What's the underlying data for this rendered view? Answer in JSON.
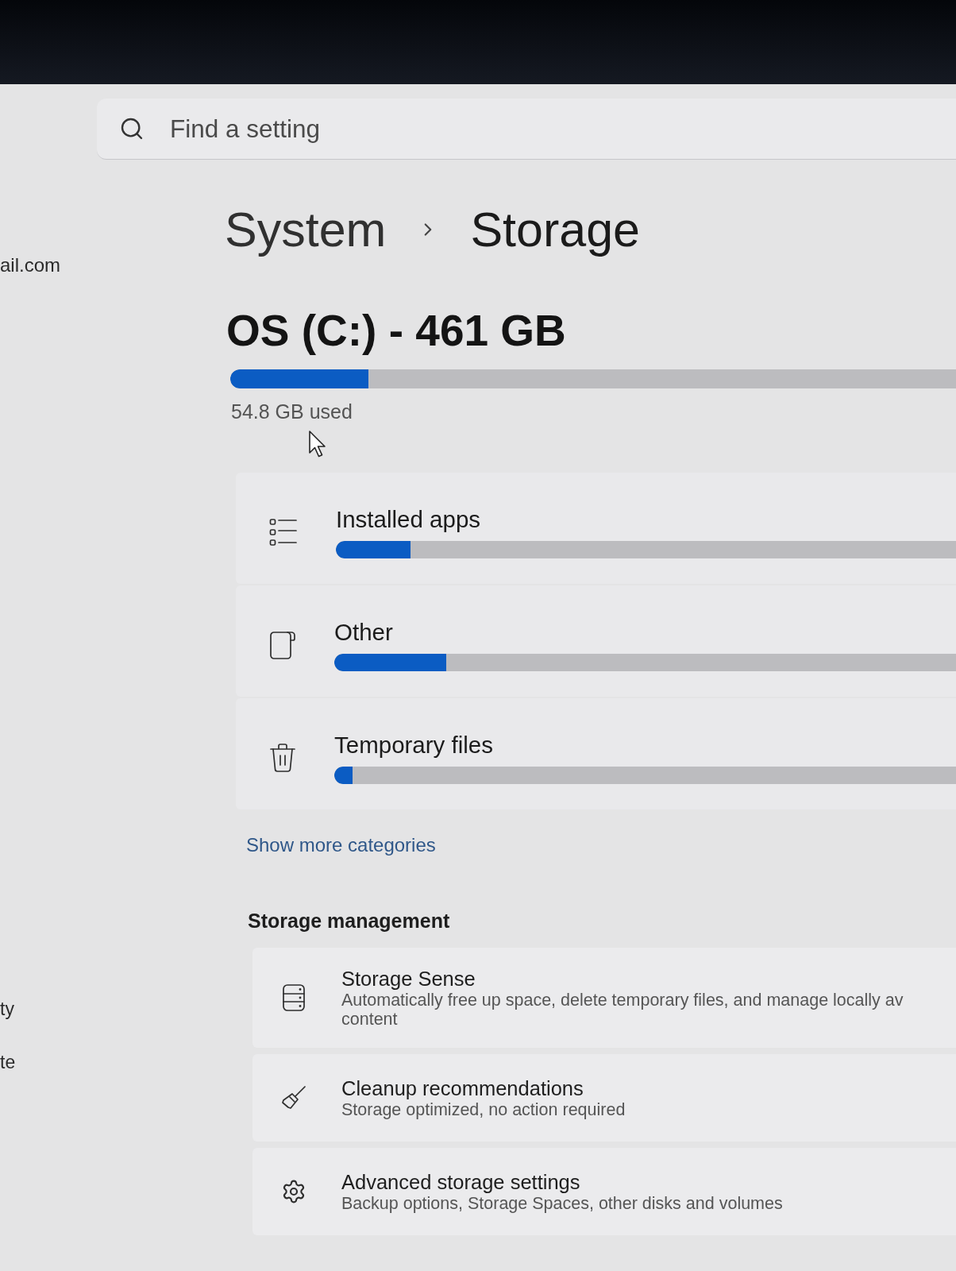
{
  "search": {
    "placeholder": "Find a setting"
  },
  "sidebar": {
    "account_email": "ail.com",
    "items": [
      {
        "label": "ty"
      },
      {
        "label": "te"
      }
    ]
  },
  "breadcrumb": [
    {
      "label": "System"
    },
    {
      "label": "Storage"
    }
  ],
  "drive": {
    "title": "OS (C:) - 461 GB",
    "level": 0.19,
    "used": "54.8 GB used"
  },
  "categories": [
    {
      "kind": "apps",
      "label": "Installed apps",
      "level": 0.12
    },
    {
      "kind": "other",
      "label": "Other",
      "level": 0.18
    },
    {
      "kind": "temp",
      "label": "Temporary files",
      "level": 0.03
    }
  ],
  "show_more": {
    "label": "Show more categories"
  },
  "storage_management": {
    "heading": "Storage management",
    "items": [
      {
        "kind": "storage_sense",
        "title": "Storage Sense",
        "description": "Automatically free up space, delete temporary files, and manage locally av\ncontent"
      },
      {
        "kind": "cleanup",
        "title": "Cleanup recommendations",
        "description": "Storage optimized, no action required"
      },
      {
        "kind": "advanced",
        "title": "Advanced storage settings",
        "description": "Backup options, Storage Spaces, other disks and volumes"
      }
    ]
  }
}
